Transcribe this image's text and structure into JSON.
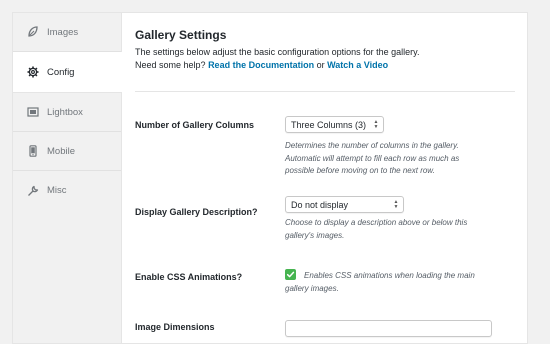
{
  "sidebar": {
    "items": [
      {
        "label": "Images",
        "icon": "leaf-icon",
        "active": false
      },
      {
        "label": "Config",
        "icon": "gear-icon",
        "active": true
      },
      {
        "label": "Lightbox",
        "icon": "lightbox-icon",
        "active": false
      },
      {
        "label": "Mobile",
        "icon": "mobile-icon",
        "active": false
      },
      {
        "label": "Misc",
        "icon": "wrench-icon",
        "active": false
      }
    ]
  },
  "main": {
    "title": "Gallery Settings",
    "intro_line1": "The settings below adjust the basic configuration options for the gallery.",
    "intro_line2_prefix": "Need some help?",
    "doc_link": "Read the Documentation",
    "or_text": "or",
    "video_link": "Watch a Video",
    "columns": {
      "label": "Number of Gallery Columns",
      "value": "Three Columns (3)",
      "desc_line1": "Determines the number of columns in the gallery.",
      "desc_line2": "Automatic will attempt to fill each row as much as",
      "desc_line3": "possible before moving on to the next row."
    },
    "description": {
      "label": "Display Gallery Description?",
      "value": "Do not display",
      "desc_line1": "Choose to display a description above or below this",
      "desc_line2": "gallery's images."
    },
    "css_animations": {
      "label": "Enable CSS Animations?",
      "checked": true,
      "desc_line1": "Enables CSS animations when loading the main",
      "desc_line2": "gallery images."
    },
    "next_row_label": "Image Dimensions"
  },
  "colors": {
    "link": "#0073aa",
    "check_green": "#46b450"
  }
}
